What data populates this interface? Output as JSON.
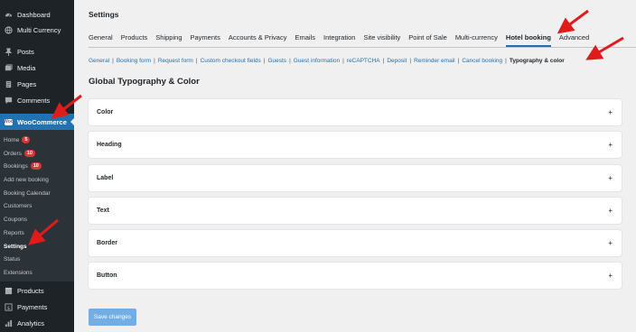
{
  "sidebar": {
    "top_items": [
      {
        "label": "Dashboard",
        "icon": "dashboard-icon"
      },
      {
        "label": "Multi Currency",
        "icon": "globe-icon"
      },
      {
        "label": "Posts",
        "icon": "pin-icon"
      },
      {
        "label": "Media",
        "icon": "media-icon"
      },
      {
        "label": "Pages",
        "icon": "page-icon"
      },
      {
        "label": "Comments",
        "icon": "comment-icon"
      }
    ],
    "woocommerce": "WooCommerce",
    "woo_logo": "Woo",
    "submenu": [
      {
        "label": "Home",
        "badge": "5"
      },
      {
        "label": "Orders",
        "badge": "10"
      },
      {
        "label": "Bookings",
        "badge": "10"
      },
      {
        "label": "Add new booking"
      },
      {
        "label": "Booking Calendar"
      },
      {
        "label": "Customers"
      },
      {
        "label": "Coupons"
      },
      {
        "label": "Reports"
      },
      {
        "label": "Settings"
      },
      {
        "label": "Status"
      },
      {
        "label": "Extensions"
      }
    ],
    "bottom_items": [
      {
        "label": "Products",
        "icon": "box-icon"
      },
      {
        "label": "Payments",
        "icon": "payments-icon"
      },
      {
        "label": "Analytics",
        "icon": "analytics-icon"
      }
    ]
  },
  "page_title": "Settings",
  "tabs": [
    "General",
    "Products",
    "Shipping",
    "Payments",
    "Accounts & Privacy",
    "Emails",
    "Integration",
    "Site visibility",
    "Point of Sale",
    "Multi-currency",
    "Hotel booking",
    "Advanced"
  ],
  "active_tab": "Hotel booking",
  "subnav": [
    "General",
    "Booking form",
    "Request form",
    "Custom checkout fields",
    "Guests",
    "Guest information",
    "reCAPTCHA",
    "Deposit",
    "Reminder email",
    "Cancel booking",
    "Typography & color"
  ],
  "active_subnav": "Typography & color",
  "section_heading": "Global Typography & Color",
  "panels": [
    "Color",
    "Heading",
    "Label",
    "Text",
    "Border",
    "Button"
  ],
  "panel_toggle": "+",
  "save_button": "Save changes",
  "colors": {
    "sidebar": "#1d2327",
    "submenu": "#2c3338",
    "accent": "#2271b1",
    "arrow": "#e01b1b",
    "badge": "#d63638",
    "save_disabled": "#72aee6"
  }
}
